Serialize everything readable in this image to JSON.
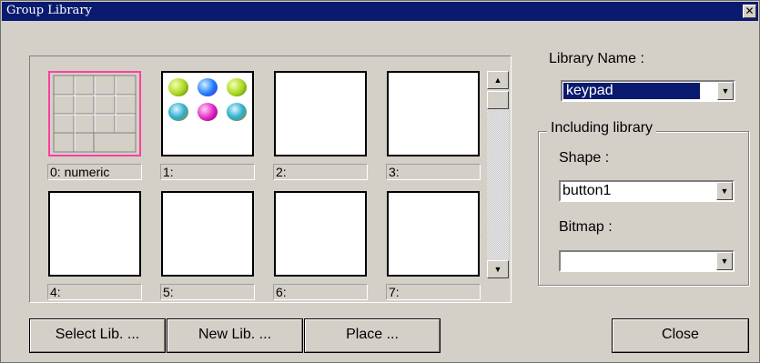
{
  "window": {
    "title": "Group Library",
    "close_glyph": "✕"
  },
  "tiles": [
    {
      "label": "0: numeric"
    },
    {
      "label": "1:"
    },
    {
      "label": "2:"
    },
    {
      "label": "3:"
    },
    {
      "label": "4:"
    },
    {
      "label": "5:"
    },
    {
      "label": "6:"
    },
    {
      "label": "7:"
    }
  ],
  "scrollbar": {
    "up": "▲",
    "down": "▼"
  },
  "buttons": {
    "select_lib": "Select Lib. ...",
    "new_lib": "New Lib. ...",
    "place": "Place ...",
    "close": "Close"
  },
  "library_name": {
    "label": "Library  Name :",
    "value": "keypad"
  },
  "including": {
    "title": "Including library",
    "shape_label": "Shape :",
    "shape_value": "button1",
    "bitmap_label": "Bitmap :",
    "bitmap_value": ""
  },
  "dropdown_glyph": "▼",
  "colors": {
    "title_bar": "#0a1a6e",
    "selection_border": "#ff3f9f"
  }
}
